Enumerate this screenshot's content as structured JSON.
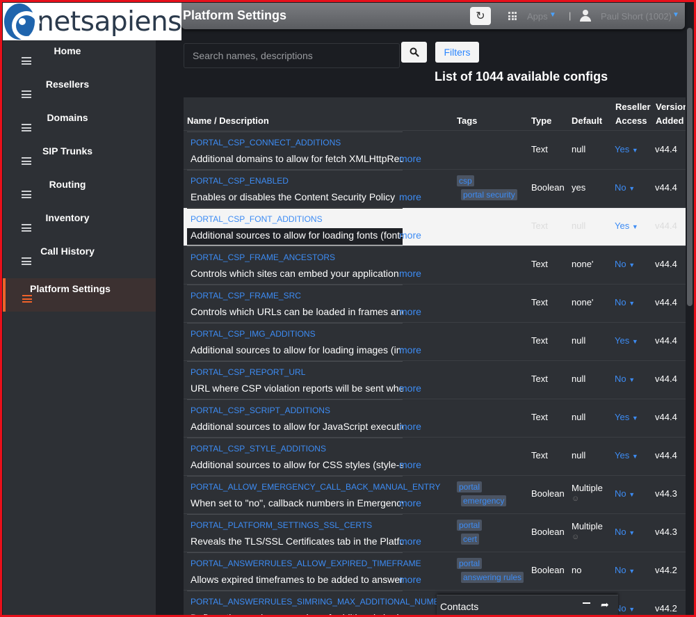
{
  "brand": {
    "logo_text": "netsapiens"
  },
  "header": {
    "title": "Platform Settings",
    "refresh_icon": "refresh-icon",
    "apps_label": "Apps",
    "user_label": "Paul Short (1002)"
  },
  "sidebar": {
    "items": [
      {
        "label": "Home",
        "icon": "menu-icon",
        "active": false
      },
      {
        "label": "Resellers",
        "icon": "menu-icon",
        "active": false
      },
      {
        "label": "Domains",
        "icon": "menu-icon",
        "active": false
      },
      {
        "label": "SIP Trunks",
        "icon": "menu-icon",
        "active": false
      },
      {
        "label": "Routing",
        "icon": "menu-icon",
        "active": false
      },
      {
        "label": "Inventory",
        "icon": "menu-icon",
        "active": false
      },
      {
        "label": "Call History",
        "icon": "menu-icon",
        "active": false
      },
      {
        "label": "Platform Settings",
        "icon": "menu-icon",
        "active": true
      }
    ]
  },
  "search": {
    "placeholder": "Search names, descriptions"
  },
  "filters_label": "Filters",
  "list_title": "List of 1044 available configs",
  "table": {
    "headers": {
      "name": "Name / Description",
      "tags": "Tags",
      "type": "Type",
      "default": "Default",
      "access_line1": "Reseller",
      "access_line2": "Access",
      "version_line1": "Version",
      "version_line2": "Added"
    },
    "more_label": "more",
    "rows": [
      {
        "name": "PORTAL_CSP_CONNECT_ADDITIONS",
        "desc": "Additional domains to allow for fetch XMLHttpRequest",
        "tags": [],
        "type": "Text",
        "default": "null",
        "default_sub": "",
        "access": "Yes",
        "version": "v44.4"
      },
      {
        "name": "PORTAL_CSP_ENABLED",
        "desc": "Enables or disables the Content Security Policy",
        "tags": [
          "csp",
          "portal security"
        ],
        "type": "Boolean",
        "default": "yes",
        "default_sub": "",
        "access": "No",
        "version": "v44.4"
      },
      {
        "name": "PORTAL_CSP_FONT_ADDITIONS",
        "desc": "Additional sources to allow for loading fonts (font-src)",
        "tags": [],
        "type": "Text",
        "default": "null",
        "default_sub": "",
        "access": "Yes",
        "version": "v44.4"
      },
      {
        "name": "PORTAL_CSP_FRAME_ANCESTORS",
        "desc": "Controls which sites can embed your application",
        "tags": [],
        "type": "Text",
        "default": "none'",
        "default_sub": "",
        "access": "No",
        "version": "v44.4"
      },
      {
        "name": "PORTAL_CSP_FRAME_SRC",
        "desc": "Controls which URLs can be loaded in frames and iframes",
        "tags": [],
        "type": "Text",
        "default": "none'",
        "default_sub": "",
        "access": "No",
        "version": "v44.4"
      },
      {
        "name": "PORTAL_CSP_IMG_ADDITIONS",
        "desc": "Additional sources to allow for loading images (img-src)",
        "tags": [],
        "type": "Text",
        "default": "null",
        "default_sub": "",
        "access": "Yes",
        "version": "v44.4"
      },
      {
        "name": "PORTAL_CSP_REPORT_URL",
        "desc": "URL where CSP violation reports will be sent when enabled",
        "tags": [],
        "type": "Text",
        "default": "null",
        "default_sub": "",
        "access": "No",
        "version": "v44.4"
      },
      {
        "name": "PORTAL_CSP_SCRIPT_ADDITIONS",
        "desc": "Additional sources to allow for JavaScript execution",
        "tags": [],
        "type": "Text",
        "default": "null",
        "default_sub": "",
        "access": "Yes",
        "version": "v44.4"
      },
      {
        "name": "PORTAL_CSP_STYLE_ADDITIONS",
        "desc": "Additional sources to allow for CSS styles (style-src)",
        "tags": [],
        "type": "Text",
        "default": "null",
        "default_sub": "",
        "access": "Yes",
        "version": "v44.4"
      },
      {
        "name": "PORTAL_ALLOW_EMERGENCY_CALL_BACK_MANUAL_ENTRY",
        "desc": "When set to \"no\", callback numbers in Emergency",
        "tags": [
          "portal",
          "emergency"
        ],
        "type": "Boolean",
        "default": "Multiple",
        "default_sub": "☺",
        "access": "No",
        "version": "v44.3"
      },
      {
        "name": "PORTAL_PLATFORM_SETTINGS_SSL_CERTS",
        "desc": "Reveals the TLS/SSL Certificates tab in the Platform",
        "tags": [
          "portal",
          "cert"
        ],
        "type": "Boolean",
        "default": "Multiple",
        "default_sub": "☺",
        "access": "No",
        "version": "v44.3"
      },
      {
        "name": "PORTAL_ANSWERRULES_ALLOW_EXPIRED_TIMEFRAME",
        "desc": "Allows expired timeframes to be added to answer rules",
        "tags": [
          "portal",
          "answering rules"
        ],
        "type": "Boolean",
        "default": "no",
        "default_sub": "",
        "access": "No",
        "version": "v44.2"
      },
      {
        "name": "PORTAL_ANSWERRULES_SIMRING_MAX_ADDITIONAL_NUMBERS",
        "desc": "Defines the maximum number of additional simring",
        "tags": [],
        "type": "",
        "default": "",
        "default_sub": "",
        "access": "No",
        "version": "v44.2"
      }
    ]
  },
  "contacts": {
    "label": "Contacts"
  },
  "colors": {
    "accent": "#3d8cf4",
    "active_nav": "#f0622a",
    "frame": "#e8101b"
  }
}
